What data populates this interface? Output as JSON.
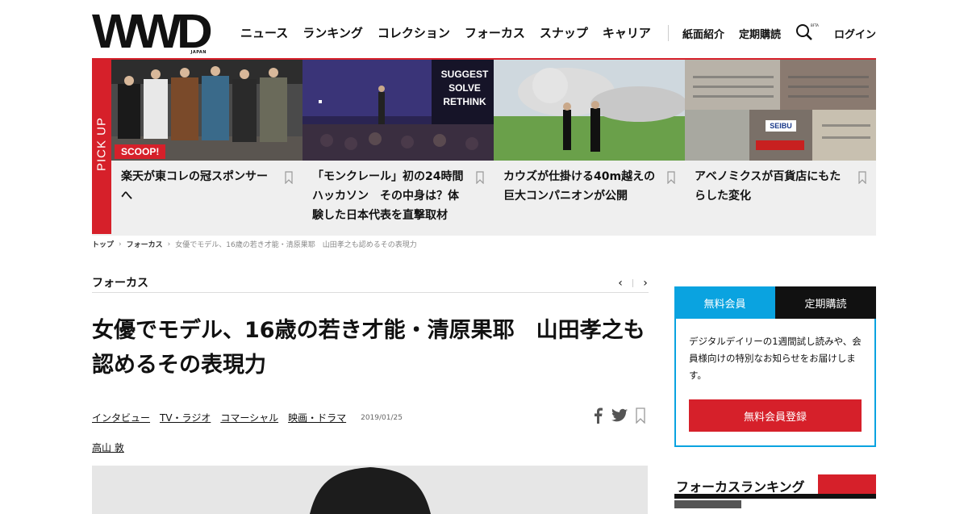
{
  "header": {
    "logo": "WWD",
    "logo_sub": "JAPAN",
    "nav": [
      "ニュース",
      "ランキング",
      "コレクション",
      "フォーカス",
      "スナップ",
      "キャリア"
    ],
    "nav2": [
      "紙面紹介",
      "定期購読"
    ],
    "search_badge": "BFTA",
    "login": "ログイン"
  },
  "pickup": {
    "label": "PICK UP",
    "cards": [
      {
        "title": "楽天が東コレの冠スポンサーへ",
        "badge": "SCOOP!"
      },
      {
        "title": "「モンクレール」初の24時間ハッカソン　その中身は？体験した日本代表を直撃取材",
        "screen_text": "SUGGEST SOLVE RETHINK"
      },
      {
        "title": "カウズが仕掛ける40m越えの巨大コンパニオンが公開"
      },
      {
        "title": "アベノミクスが百貨店にもたらした変化",
        "sign": "SEIBU"
      }
    ]
  },
  "breadcrumb": [
    "トップ",
    "フォーカス",
    "女優でモデル、16歳の若き才能・清原果耶　山田孝之も認めるその表現力"
  ],
  "article": {
    "section": "フォーカス",
    "headline": "女優でモデル、16歳の若き才能・清原果耶　山田孝之も認めるその表現力",
    "tags": [
      "インタビュー",
      "TV・ラジオ",
      "コマーシャル",
      "映画・ドラマ"
    ],
    "date": "2019/01/25",
    "author": "高山 敦"
  },
  "sidebar": {
    "tab_free": "無料会員",
    "tab_sub": "定期購読",
    "description": "デジタルデイリーの1週間試し読みや、会員様向けの特別なお知らせをお届けします。",
    "register_button": "無料会員登録",
    "ranking_title": "フォーカスランキング"
  },
  "colors": {
    "brand_red": "#d6202a",
    "accent_blue": "#0aa3e0"
  }
}
